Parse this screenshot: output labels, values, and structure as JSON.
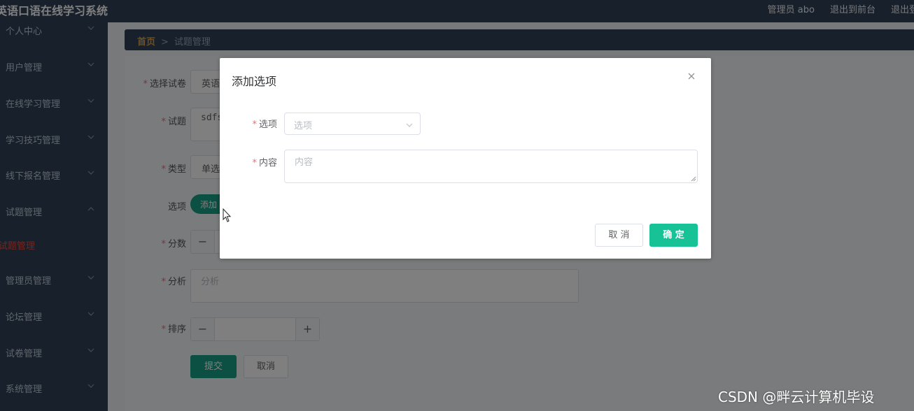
{
  "app": {
    "title": "英语口语在线学习系统"
  },
  "topbar": {
    "links": [
      "管理员 abo",
      "退出到前台",
      "退出登"
    ]
  },
  "sidebar": {
    "items": [
      {
        "label": "个人中心",
        "chevron": "down"
      },
      {
        "label": "用户管理",
        "chevron": "down"
      },
      {
        "label": "在线学习管理",
        "chevron": "down"
      },
      {
        "label": "学习技巧管理",
        "chevron": "down"
      },
      {
        "label": "线下报名管理",
        "chevron": "down"
      },
      {
        "label": "试题管理",
        "chevron": "up"
      },
      {
        "label": "试题管理",
        "chevron": "none",
        "active": true
      },
      {
        "label": "管理员管理",
        "chevron": "down"
      },
      {
        "label": "论坛管理",
        "chevron": "down"
      },
      {
        "label": "试卷管理",
        "chevron": "down"
      },
      {
        "label": "系统管理",
        "chevron": "down"
      }
    ]
  },
  "breadcrumb": {
    "home": "首页",
    "separator": ">",
    "current": "试题管理"
  },
  "form": {
    "paper_label": "选择试卷",
    "paper_value": "英语",
    "question_label": "试题",
    "question_value": "sdfs",
    "type_label": "类型",
    "type_value": "单选",
    "options_label": "选项",
    "options_add": "添加",
    "score_label": "分数",
    "score_minus": "−",
    "analysis_label": "分析",
    "analysis_placeholder": "分析",
    "sort_label": "排序",
    "sort_minus": "−",
    "sort_plus": "+",
    "submit": "提交",
    "cancel": "取消"
  },
  "dialog": {
    "title": "添加选项",
    "option_label": "选项",
    "option_placeholder": "选项",
    "content_label": "内容",
    "content_placeholder": "内容",
    "cancel": "取 消",
    "ok": "确 定"
  },
  "watermark": "CSDN @畔云计算机毕设",
  "colors": {
    "sidebar": "#304156",
    "accent": "#16c296",
    "active": "#e74c3c",
    "required": "#f56c6c"
  },
  "icons": {
    "chevron": "chevron-icon",
    "close": "close-icon",
    "cursor": "mouse-cursor-icon"
  }
}
